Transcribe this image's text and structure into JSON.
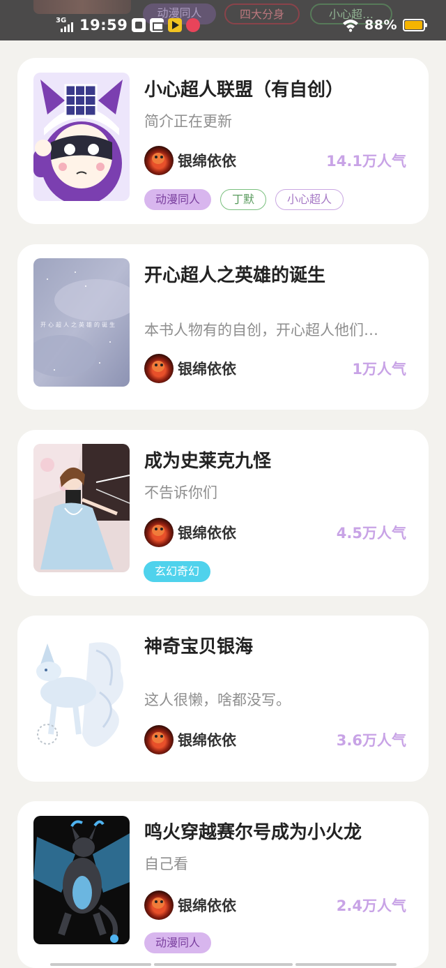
{
  "status_bar": {
    "network": "3G",
    "time": "19:59",
    "battery_percent": "88%",
    "battery_level": 0.88,
    "icons": [
      "signal-icon",
      "gallery-app-icon",
      "message-app-icon",
      "video-app-icon",
      "social-app-icon",
      "wifi-icon",
      "battery-icon"
    ]
  },
  "top_tags": [
    "动漫同人",
    "四大分身",
    "小心超…"
  ],
  "books": [
    {
      "title": "小心超人联盟（有自创）",
      "description": "简介正在更新",
      "author": "银绵依依",
      "popularity": "14.1万人气",
      "cover": "cartoon-hero-cover",
      "tags": [
        {
          "label": "动漫同人",
          "style": "filled-purple"
        },
        {
          "label": "丁默",
          "style": "outline-green"
        },
        {
          "label": "小心超人",
          "style": "outline-purple"
        }
      ]
    },
    {
      "title": "开心超人之英雄的诞生",
      "description": "本书人物有的自创，开心超人他们…",
      "author": "银绵依依",
      "popularity": "1万人气",
      "cover": "starry-blue-cover",
      "cover_text": "开心超人之英雄的诞生",
      "tags": []
    },
    {
      "title": "成为史莱克九怪",
      "description": "不告诉你们",
      "author": "银绵依依",
      "popularity": "4.5万人气",
      "cover": "anime-girl-cover",
      "tags": [
        {
          "label": "玄幻奇幻",
          "style": "filled-cyan"
        }
      ]
    },
    {
      "title": "神奇宝贝银海",
      "description": "这人很懒，啥都没写。",
      "author": "银绵依依",
      "popularity": "3.6万人气",
      "cover": "white-fox-cover",
      "tags": []
    },
    {
      "title": "鸣火穿越赛尔号成为小火龙",
      "description": "自己看",
      "author": "银绵依依",
      "popularity": "2.4万人气",
      "cover": "dragon-cover",
      "tags": [
        {
          "label": "动漫同人",
          "style": "filled-purple"
        }
      ]
    }
  ]
}
